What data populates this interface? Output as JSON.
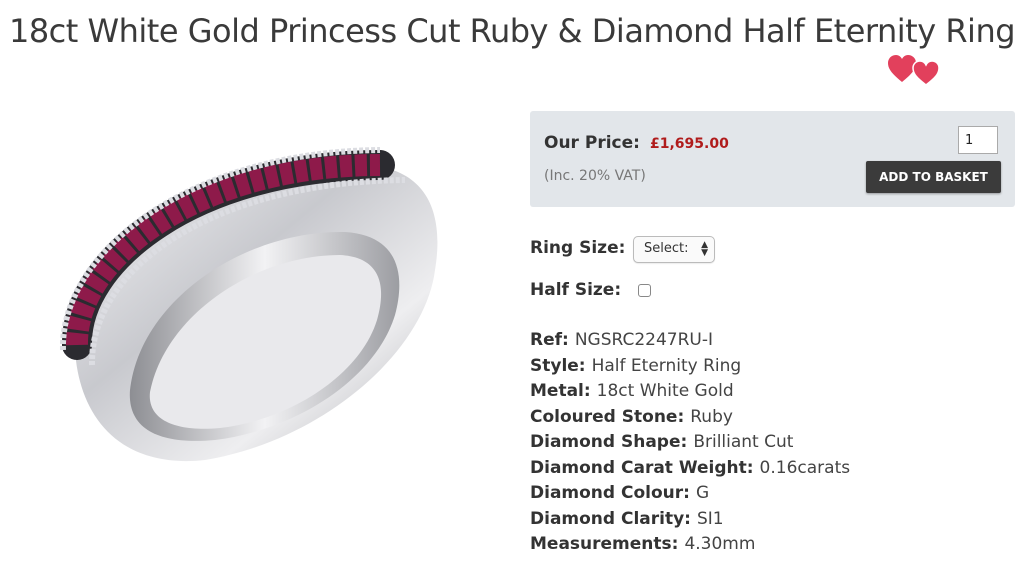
{
  "product": {
    "title": "18ct White Gold Princess Cut Ruby & Diamond Half Eternity Ring"
  },
  "icons": {
    "wishlist": "hearts-icon",
    "select_arrows": "up-down-arrows-icon"
  },
  "pricing": {
    "label": "Our Price:",
    "price": "£1,695.00",
    "vat_note": "(Inc. 20% VAT)",
    "quantity": "1",
    "add_button": "ADD TO BASKET"
  },
  "options": {
    "ring_size_label": "Ring Size:",
    "ring_size_value": "Select:",
    "half_size_label": "Half Size:",
    "half_size_checked": false
  },
  "specs": [
    {
      "key": "Ref:",
      "value": "NGSRC2247RU-I"
    },
    {
      "key": "Style:",
      "value": "Half Eternity Ring"
    },
    {
      "key": "Metal:",
      "value": "18ct White Gold"
    },
    {
      "key": "Coloured Stone:",
      "value": "Ruby"
    },
    {
      "key": "Diamond Shape:",
      "value": "Brilliant Cut"
    },
    {
      "key": "Diamond Carat Weight:",
      "value": "0.16carats"
    },
    {
      "key": "Diamond Colour:",
      "value": "G"
    },
    {
      "key": "Diamond Clarity:",
      "value": "SI1"
    },
    {
      "key": "Measurements:",
      "value": "4.30mm"
    }
  ],
  "colors": {
    "price": "#b01c1c",
    "heart": "#e2405c",
    "price_box": "#e2e6ea",
    "button": "#3b3b3b",
    "ruby": "#8e1a4a"
  }
}
